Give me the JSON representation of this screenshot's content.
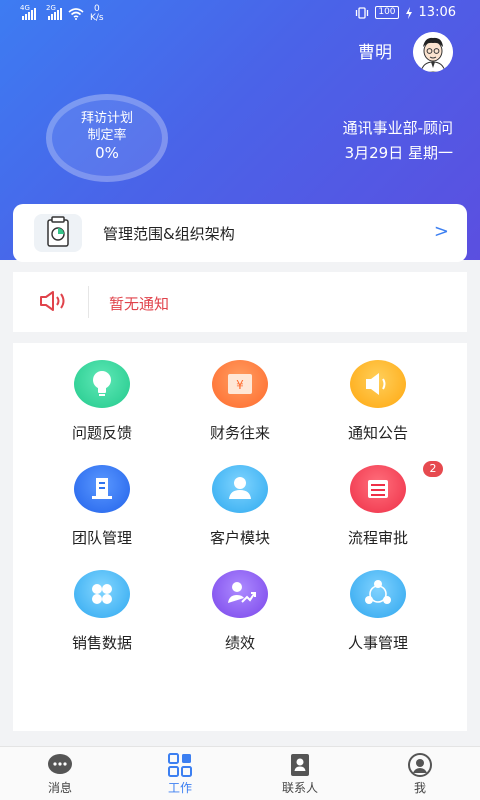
{
  "status_bar": {
    "sim1": "4G",
    "sim2": "2G",
    "speed_value": "0",
    "speed_unit": "K/s",
    "battery": "100",
    "time": "13:06"
  },
  "user": {
    "name": "曹明",
    "department": "通讯事业部-顾问",
    "date": "3月29日 星期一"
  },
  "visit_plan": {
    "label_line1": "拜访计划",
    "label_line2": "制定率",
    "value": "0%"
  },
  "management": {
    "label": "管理范围&组织架构",
    "arrow": ">"
  },
  "notice": {
    "text": "暂无通知"
  },
  "grid": {
    "items": [
      {
        "label": "问题反馈",
        "icon": "lightbulb-icon",
        "color": "#2fd39a"
      },
      {
        "label": "财务往来",
        "icon": "yen-icon",
        "color": "#ff7a3d"
      },
      {
        "label": "通知公告",
        "icon": "speaker-icon",
        "color": "#ffb21e"
      },
      {
        "label": "团队管理",
        "icon": "building-icon",
        "color": "#2f74f0"
      },
      {
        "label": "客户模块",
        "icon": "person-icon",
        "color": "#3fb8f4"
      },
      {
        "label": "流程审批",
        "icon": "list-icon",
        "color": "#f0455a",
        "badge": "2"
      },
      {
        "label": "销售数据",
        "icon": "circles-icon",
        "color": "#3eb9f6"
      },
      {
        "label": "绩效",
        "icon": "performance-icon",
        "color": "#8a5cf0"
      },
      {
        "label": "人事管理",
        "icon": "network-icon",
        "color": "#3cb7f3"
      }
    ]
  },
  "bottom_nav": {
    "items": [
      {
        "label": "消息",
        "icon": "chat-icon"
      },
      {
        "label": "工作",
        "icon": "grid-icon"
      },
      {
        "label": "联系人",
        "icon": "contacts-icon"
      },
      {
        "label": "我",
        "icon": "profile-icon"
      }
    ],
    "active_index": 1
  }
}
